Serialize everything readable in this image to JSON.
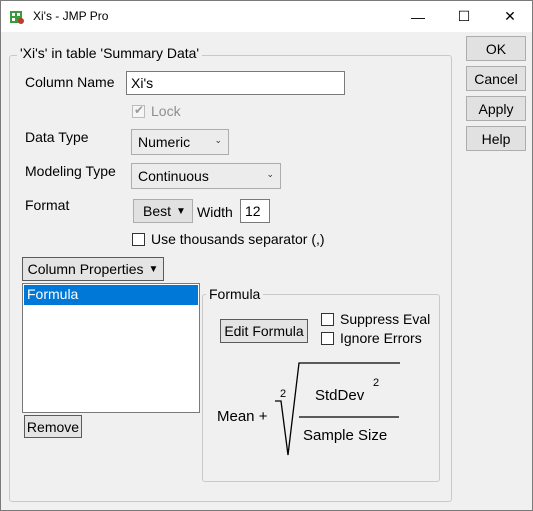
{
  "window": {
    "title": "Xi's - JMP Pro",
    "minimize": "—",
    "maximize": "☐",
    "close": "✕"
  },
  "group": {
    "title": "'Xi's' in table 'Summary Data'"
  },
  "fields": {
    "column_name_label": "Column Name",
    "column_name_value": "Xi's",
    "lock_label": "Lock",
    "data_type_label": "Data Type",
    "data_type_value": "Numeric",
    "modeling_type_label": "Modeling Type",
    "modeling_type_value": "Continuous",
    "format_label": "Format",
    "format_value": "Best",
    "width_label": "Width",
    "width_value": "12",
    "thousands_label": "Use thousands separator (,)"
  },
  "column_properties": {
    "button_label": "Column Properties",
    "items": [
      "Formula"
    ],
    "remove_label": "Remove"
  },
  "formula_panel": {
    "title": "Formula",
    "edit_label": "Edit Formula",
    "suppress_label": "Suppress Eval",
    "ignore_label": "Ignore Errors",
    "expr_mean": "Mean +",
    "root_index": "2",
    "numerator": "StdDev",
    "numerator_exp": "2",
    "denominator": "Sample Size"
  },
  "side_buttons": {
    "ok": "OK",
    "cancel": "Cancel",
    "apply": "Apply",
    "help": "Help"
  }
}
